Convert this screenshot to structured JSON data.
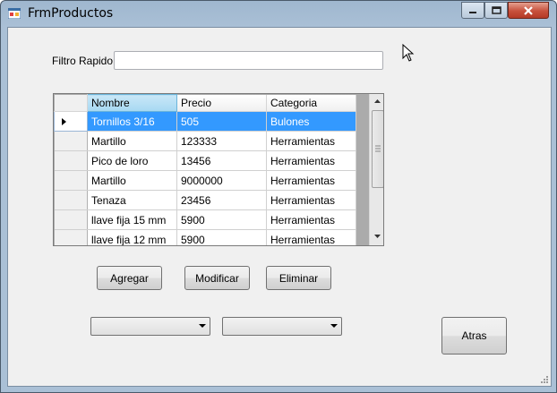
{
  "window": {
    "title": "FrmProductos"
  },
  "filter": {
    "label": "Filtro Rapido",
    "value": ""
  },
  "grid": {
    "columns": [
      "Nombre",
      "Precio",
      "Categoria"
    ],
    "rows": [
      [
        "Tornillos 3/16",
        "505",
        "Bulones"
      ],
      [
        "Martillo",
        "123333",
        "Herramientas"
      ],
      [
        "Pico de loro",
        "13456",
        "Herramientas"
      ],
      [
        "Martillo",
        "9000000",
        "Herramientas"
      ],
      [
        "Tenaza",
        "23456",
        "Herramientas"
      ],
      [
        "llave fija 15 mm",
        "5900",
        "Herramientas"
      ],
      [
        "llave fija 12 mm",
        "5900",
        "Herramientas"
      ]
    ]
  },
  "buttons": {
    "add": "Agregar",
    "edit": "Modificar",
    "delete": "Eliminar",
    "back": "Atras"
  },
  "combos": {
    "first_value": "",
    "second_value": ""
  }
}
